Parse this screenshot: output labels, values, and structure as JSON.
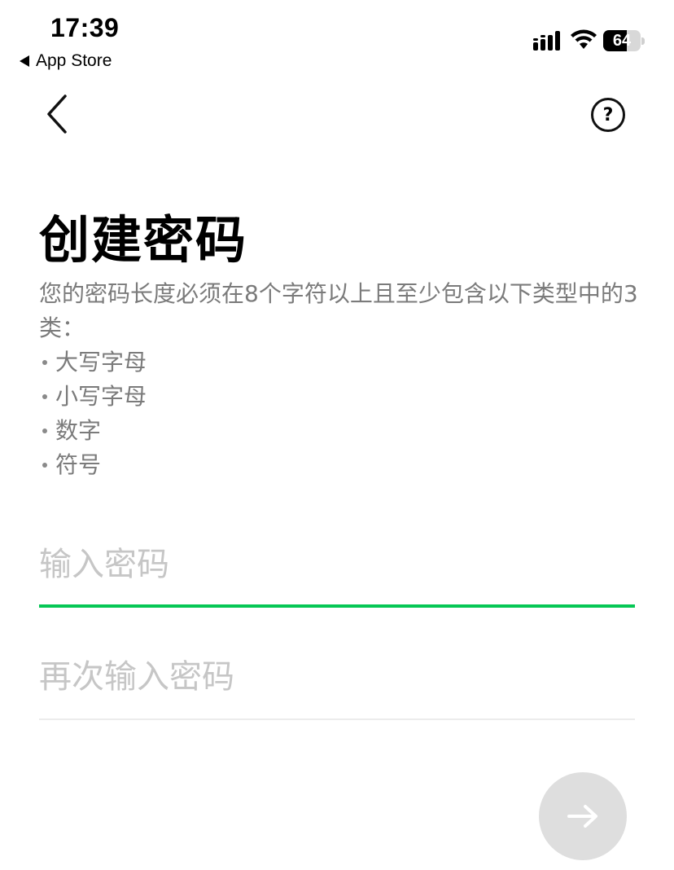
{
  "status_bar": {
    "time": "17:39",
    "back_app_label": "App Store",
    "battery_level": "64",
    "battery_fraction": 0.64,
    "icons": [
      "signal-bars-icon",
      "wifi-icon",
      "battery-icon"
    ]
  },
  "nav": {
    "back_icon": "chevron-left-icon",
    "help_label": "?"
  },
  "title": "创建密码",
  "description": "您的密码长度必须在8个字符以上且至少包含以下类型中的3类：",
  "requirements": [
    "大写字母",
    "小写字母",
    "数字",
    "符号"
  ],
  "password_field": {
    "value": "",
    "placeholder": "输入密码"
  },
  "confirm_field": {
    "value": "",
    "placeholder": "再次输入密码"
  },
  "next_button": {
    "icon": "arrow-right-icon",
    "enabled": false
  },
  "colors": {
    "accent": "#06c755",
    "muted_text": "#7b7b7b",
    "placeholder": "#c6c6c6",
    "disabled_button": "#dedede"
  }
}
